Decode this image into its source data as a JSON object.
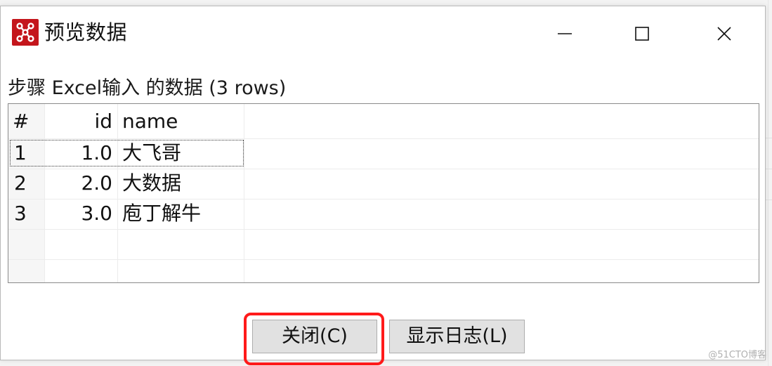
{
  "window": {
    "title": "预览数据",
    "minimize_icon": "minimize-icon",
    "maximize_icon": "maximize-icon",
    "close_icon": "close-icon"
  },
  "caption": "步骤 Excel输入 的数据  (3 rows)",
  "table": {
    "columns": [
      "#",
      "id",
      "name"
    ],
    "rows": [
      {
        "num": "1",
        "id": "1.0",
        "name": "大飞哥"
      },
      {
        "num": "2",
        "id": "2.0",
        "name": "大数据"
      },
      {
        "num": "3",
        "id": "3.0",
        "name": "庖丁解牛"
      }
    ]
  },
  "buttons": {
    "close_label": "关闭(C)",
    "log_label": "显示日志(L)"
  },
  "watermark": "@51CTO博客",
  "colors": {
    "app_icon": "#c4161c",
    "highlight": "#ff1a1a"
  }
}
